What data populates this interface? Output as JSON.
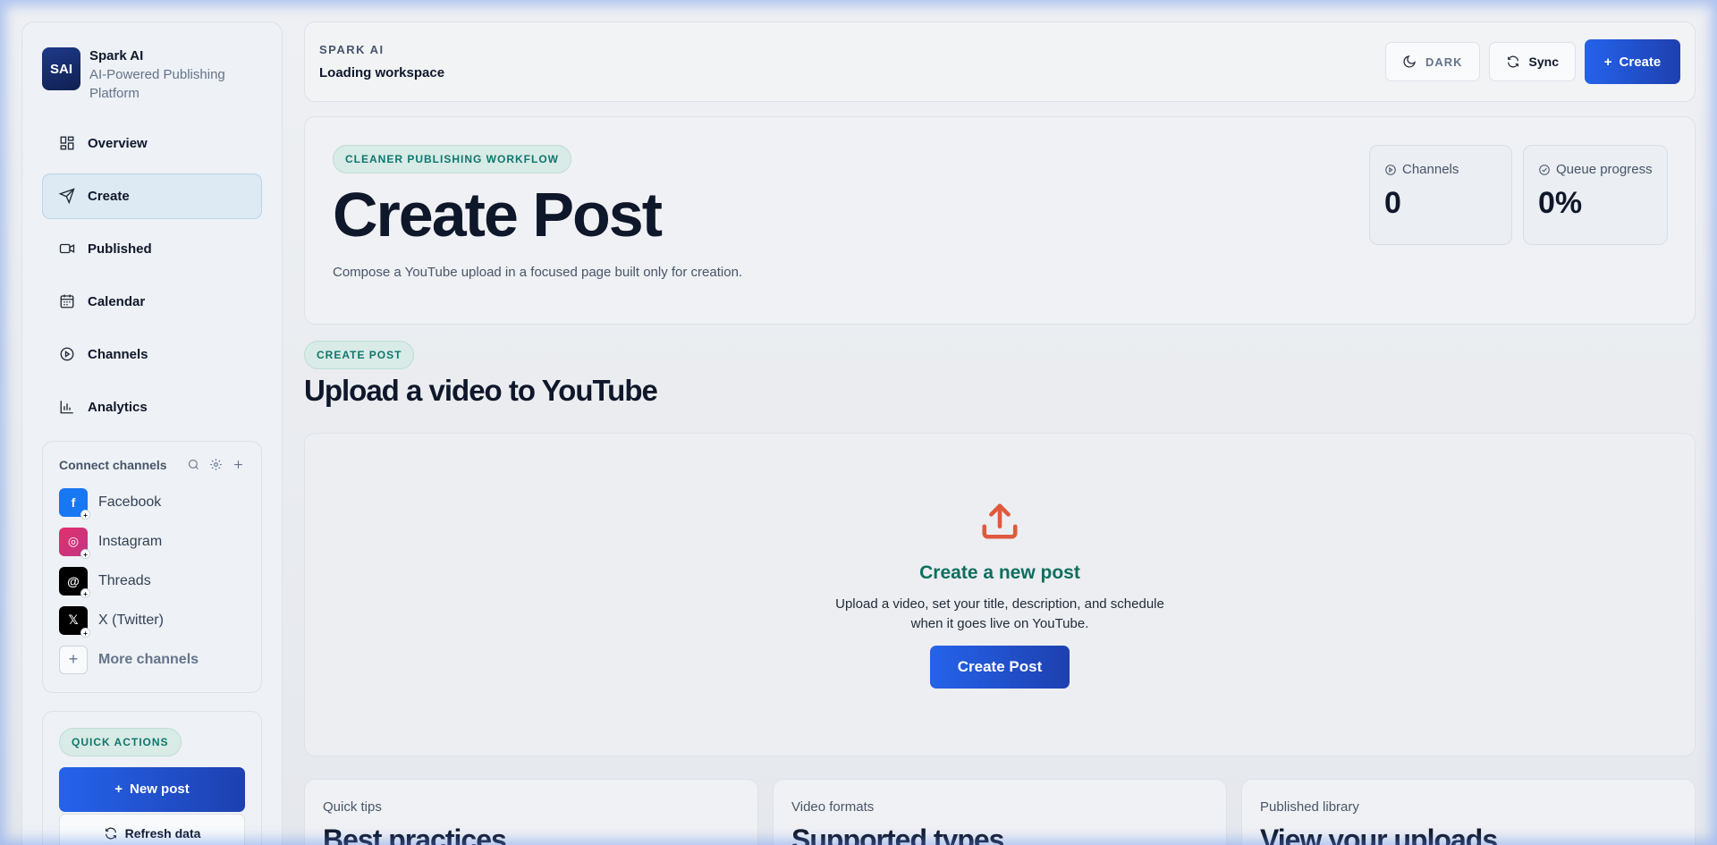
{
  "brand": {
    "logo_text": "SAI",
    "title": "Spark AI",
    "subtitle": "AI-Powered Publishing Platform"
  },
  "nav": [
    {
      "label": "Overview",
      "icon": "grid-icon",
      "active": false
    },
    {
      "label": "Create",
      "icon": "send-icon",
      "active": true
    },
    {
      "label": "Published",
      "icon": "video-icon",
      "active": false
    },
    {
      "label": "Calendar",
      "icon": "calendar-icon",
      "active": false
    },
    {
      "label": "Channels",
      "icon": "play-circle-icon",
      "active": false
    },
    {
      "label": "Analytics",
      "icon": "bar-chart-icon",
      "active": false
    }
  ],
  "connect": {
    "title": "Connect channels",
    "channels": [
      {
        "name": "Facebook",
        "color": "#1877f2"
      },
      {
        "name": "Instagram",
        "color": "#e1306c"
      },
      {
        "name": "Threads",
        "color": "#000000"
      },
      {
        "name": "X (Twitter)",
        "color": "#000000"
      }
    ],
    "more_label": "More channels"
  },
  "quick_actions": {
    "pill": "QUICK ACTIONS",
    "new_post_label": "New post",
    "refresh_label": "Refresh data"
  },
  "header": {
    "kicker": "SPARK AI",
    "subtitle": "Loading workspace",
    "dark_label": "DARK",
    "sync_label": "Sync",
    "create_label": "Create"
  },
  "hero": {
    "pill": "CLEANER PUBLISHING WORKFLOW",
    "title": "Create Post",
    "description": "Compose a YouTube upload in a focused page built only for creation.",
    "stats": {
      "channels_label": "Channels",
      "channels_value": "0",
      "queue_label": "Queue progress",
      "queue_value": "0%"
    }
  },
  "section": {
    "pill": "CREATE POST",
    "title": "Upload a video to YouTube"
  },
  "upload": {
    "title": "Create a new post",
    "description": "Upload a video, set your title, description, and schedule when it goes live on YouTube.",
    "button_label": "Create Post"
  },
  "cards": [
    {
      "kicker": "Quick tips",
      "title": "Best practices"
    },
    {
      "kicker": "Video formats",
      "title": "Supported types"
    },
    {
      "kicker": "Published library",
      "title": "View your uploads"
    }
  ],
  "colors": {
    "accent": "#2563eb",
    "accent_dark": "#1e40af",
    "teal": "#0f766e",
    "upload_icon": "#e0593d"
  }
}
